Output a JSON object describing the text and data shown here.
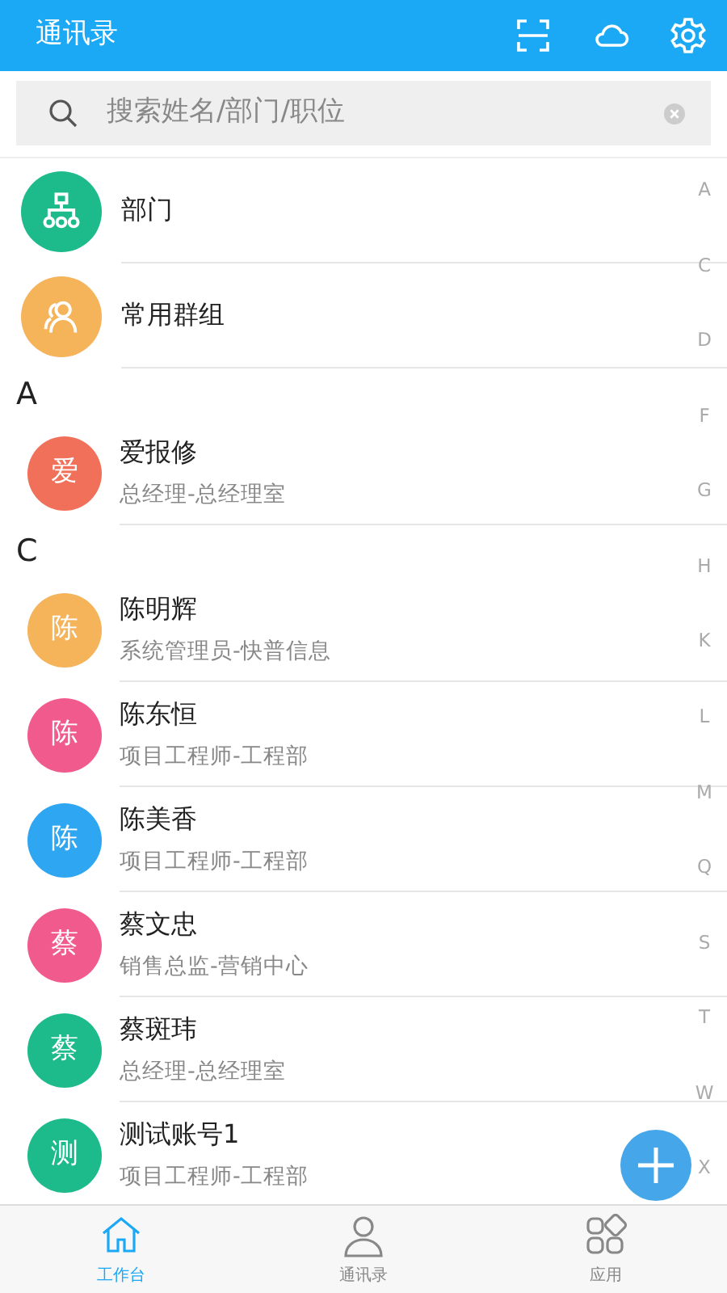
{
  "header": {
    "title": "通讯录"
  },
  "search": {
    "placeholder": "搜索姓名/部门/职位"
  },
  "shortcuts": [
    {
      "kind": "org",
      "label": "部门",
      "color": "#1dbb8b"
    },
    {
      "kind": "group",
      "label": "常用群组",
      "color": "#f5b35a"
    }
  ],
  "sections": [
    {
      "letter": "A",
      "contacts": [
        {
          "avatar": "爱",
          "name": "爱报修",
          "title": "总经理-总经理室",
          "color": "#f0705a"
        }
      ]
    },
    {
      "letter": "C",
      "contacts": [
        {
          "avatar": "陈",
          "name": "陈明辉",
          "title": "系统管理员-快普信息",
          "color": "#f5b35a"
        },
        {
          "avatar": "陈",
          "name": "陈东恒",
          "title": "项目工程师-工程部",
          "color": "#f05a8c"
        },
        {
          "avatar": "陈",
          "name": "陈美香",
          "title": "项目工程师-工程部",
          "color": "#2fa6f2"
        },
        {
          "avatar": "蔡",
          "name": "蔡文忠",
          "title": "销售总监-营销中心",
          "color": "#f05a8c"
        },
        {
          "avatar": "蔡",
          "name": "蔡斑玮",
          "title": "总经理-总经理室",
          "color": "#1dbb8b"
        },
        {
          "avatar": "测",
          "name": "测试账号1",
          "title": "项目工程师-工程部",
          "color": "#1dbb8b"
        }
      ]
    }
  ],
  "index_letters": [
    "A",
    "C",
    "D",
    "F",
    "G",
    "H",
    "K",
    "L",
    "M",
    "Q",
    "S",
    "T",
    "W",
    "X"
  ],
  "bottom_nav": [
    {
      "kind": "home",
      "label": "工作台",
      "selected": true
    },
    {
      "kind": "person",
      "label": "通讯录",
      "selected": false
    },
    {
      "kind": "apps",
      "label": "应用",
      "selected": false
    }
  ]
}
